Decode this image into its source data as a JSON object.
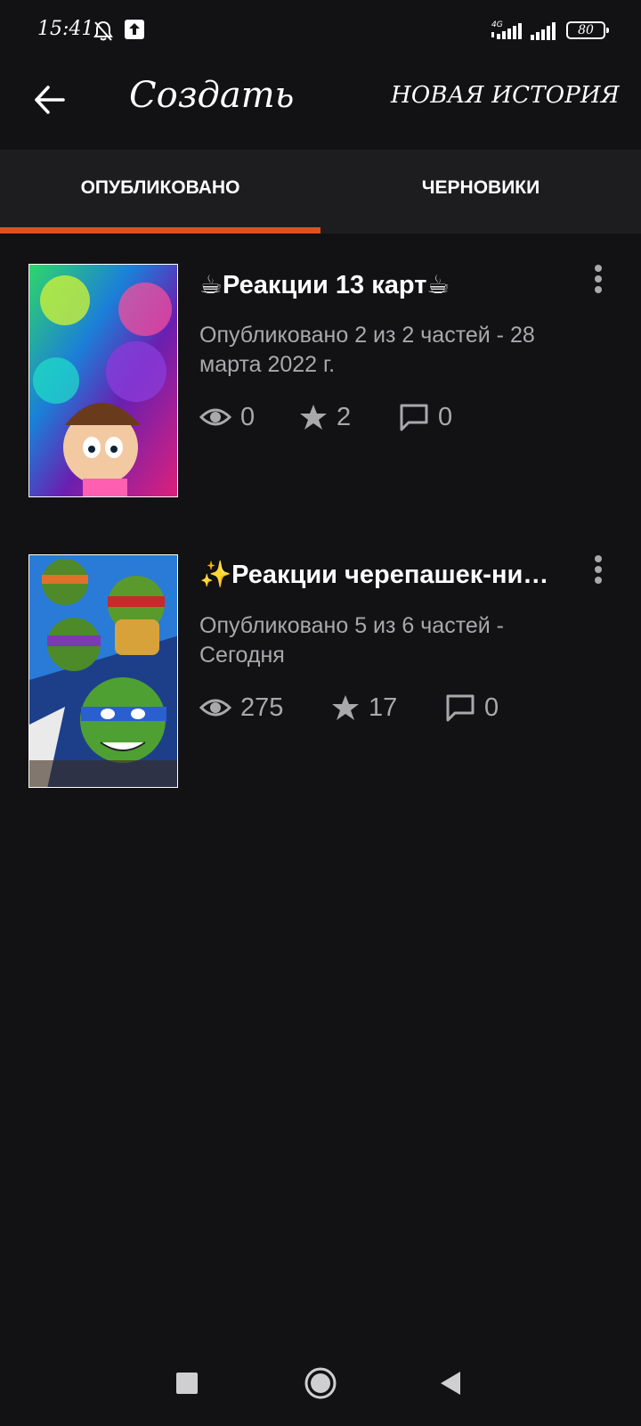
{
  "status_bar": {
    "time": "15:41",
    "battery": "80",
    "network": "4G",
    "icons": [
      "bell-off-icon",
      "upload-notification-icon",
      "signal-4g-icon",
      "signal-icon",
      "battery-icon"
    ]
  },
  "app_bar": {
    "back_icon": "arrow-left-icon",
    "title": "Создать",
    "new_story_label": "НОВАЯ ИСТОРИЯ"
  },
  "tabs": [
    {
      "label": "ОПУБЛИКОВАНО",
      "selected": true
    },
    {
      "label": "ЧЕРНОВИКИ",
      "selected": false
    }
  ],
  "colors": {
    "background": "#121114",
    "tab_background": "#1d1c1f",
    "accent": "#e04e26",
    "secondary_text": "#a9a8ab"
  },
  "stories": [
    {
      "title": "☕Реакции 13 карт☕",
      "meta": "Опубликовано 2 из 2 частей - 28 марта 2022 г.",
      "views": "0",
      "votes": "2",
      "comments": "0"
    },
    {
      "title": "✨Реакции черепашек-ни…",
      "meta": "Опубликовано 5 из 6 частей - Сегодня",
      "views": "275",
      "votes": "17",
      "comments": "0"
    }
  ],
  "nav_bar": {
    "icons": [
      "recents-square-icon",
      "home-circle-icon",
      "back-triangle-icon"
    ]
  }
}
